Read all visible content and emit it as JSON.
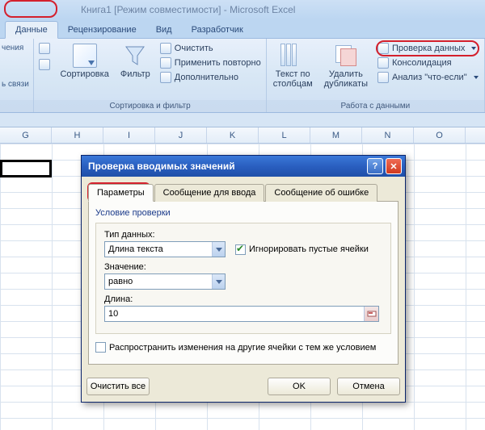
{
  "titlebar": "Книга1  [Режим совместимости] - Microsoft Excel",
  "tabs": {
    "data": "Данные",
    "review": "Рецензирование",
    "view": "Вид",
    "developer": "Разработчик"
  },
  "ribbon": {
    "conn_group": {
      "line1": "чения",
      "line2": "ь связи"
    },
    "sort_filter": {
      "sort_az": "А↓Я",
      "sort_za": "Я↓А",
      "sort": "Сортировка",
      "filter": "Фильтр",
      "clear": "Очистить",
      "reapply": "Применить повторно",
      "advanced": "Дополнительно",
      "group_label": "Сортировка и фильтр"
    },
    "data_tools": {
      "text_to_cols": "Текст по\nстолбцам",
      "remove_dup": "Удалить\nдубликаты",
      "data_validation": "Проверка данных",
      "consolidate": "Консолидация",
      "whatif": "Анализ \"что-если\"",
      "group_label": "Работа с данными"
    }
  },
  "columns": [
    "G",
    "H",
    "I",
    "J",
    "K",
    "L",
    "M",
    "N",
    "O"
  ],
  "dialog": {
    "title": "Проверка вводимых значений",
    "tabs": {
      "params": "Параметры",
      "input_msg": "Сообщение для ввода",
      "error_msg": "Сообщение об ошибке"
    },
    "group_label": "Условие проверки",
    "type_label": "Тип данных:",
    "type_value": "Длина текста",
    "ignore_blank": "Игнорировать пустые ячейки",
    "value_label": "Значение:",
    "value_value": "равно",
    "length_label": "Длина:",
    "length_value": "10",
    "propagate": "Распространить изменения на другие ячейки с тем же условием",
    "clear_all": "Очистить все",
    "ok": "OK",
    "cancel": "Отмена"
  }
}
